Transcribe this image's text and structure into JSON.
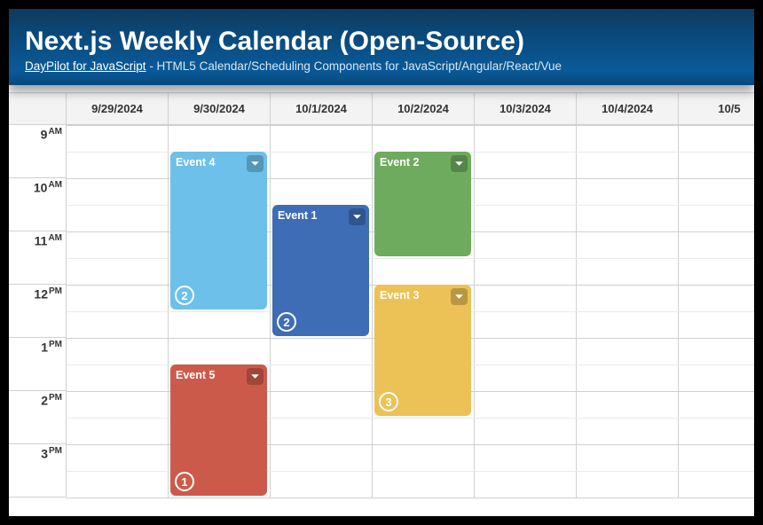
{
  "header": {
    "title": "Next.js Weekly Calendar (Open-Source)",
    "link_text": "DayPilot for JavaScript",
    "subtitle_rest": " - HTML5 Calendar/Scheduling Components for JavaScript/Angular/React/Vue"
  },
  "calendar": {
    "dates": [
      "9/29/2024",
      "9/30/2024",
      "10/1/2024",
      "10/2/2024",
      "10/3/2024",
      "10/4/2024",
      "10/5"
    ],
    "hours": [
      {
        "num": "9",
        "ampm": "AM"
      },
      {
        "num": "10",
        "ampm": "AM"
      },
      {
        "num": "11",
        "ampm": "AM"
      },
      {
        "num": "12",
        "ampm": "PM"
      },
      {
        "num": "1",
        "ampm": "PM"
      },
      {
        "num": "2",
        "ampm": "PM"
      },
      {
        "num": "3",
        "ampm": "PM"
      }
    ],
    "events": [
      {
        "id": "event-4",
        "label": "Event 4",
        "col": 1,
        "start_hour": 9.5,
        "end_hour": 12.5,
        "color": "#6cc0ea",
        "badge": "2"
      },
      {
        "id": "event-5",
        "label": "Event 5",
        "col": 1,
        "start_hour": 13.5,
        "end_hour": 16.0,
        "color": "#cc5a4a",
        "badge": "1"
      },
      {
        "id": "event-1",
        "label": "Event 1",
        "col": 2,
        "start_hour": 10.5,
        "end_hour": 13.0,
        "color": "#3e6db5",
        "badge": "2"
      },
      {
        "id": "event-2",
        "label": "Event 2",
        "col": 3,
        "start_hour": 9.5,
        "end_hour": 11.5,
        "color": "#6eab5e",
        "badge": ""
      },
      {
        "id": "event-3",
        "label": "Event 3",
        "col": 3,
        "start_hour": 12.0,
        "end_hour": 14.5,
        "color": "#ecc256",
        "badge": "3"
      }
    ]
  }
}
